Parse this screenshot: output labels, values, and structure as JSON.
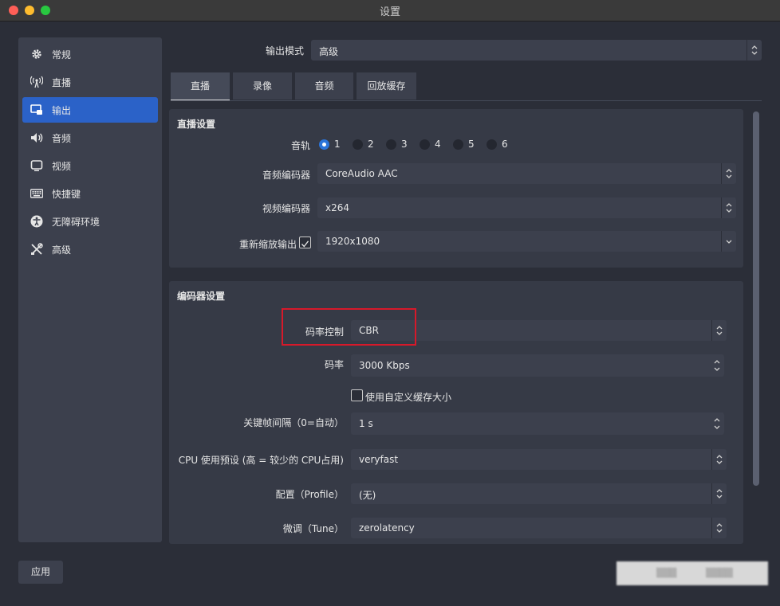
{
  "window": {
    "title": "设置"
  },
  "sidebar": {
    "items": [
      {
        "label": "常规",
        "icon": "gear-icon"
      },
      {
        "label": "直播",
        "icon": "broadcast-icon"
      },
      {
        "label": "输出",
        "icon": "output-icon",
        "active": true
      },
      {
        "label": "音频",
        "icon": "speaker-icon"
      },
      {
        "label": "视频",
        "icon": "monitor-icon"
      },
      {
        "label": "快捷键",
        "icon": "keyboard-icon"
      },
      {
        "label": "无障碍环境",
        "icon": "accessibility-icon"
      },
      {
        "label": "高级",
        "icon": "tools-icon"
      }
    ]
  },
  "output_mode": {
    "label": "输出模式",
    "value": "高级"
  },
  "tabs": [
    {
      "label": "直播",
      "active": true
    },
    {
      "label": "录像"
    },
    {
      "label": "音频"
    },
    {
      "label": "回放缓存"
    }
  ],
  "stream_settings": {
    "title": "直播设置",
    "audio_track_label": "音轨",
    "tracks": [
      "1",
      "2",
      "3",
      "4",
      "5",
      "6"
    ],
    "selected_track": "1",
    "audio_encoder_label": "音频编码器",
    "audio_encoder_value": "CoreAudio AAC",
    "video_encoder_label": "视频编码器",
    "video_encoder_value": "x264",
    "rescale_label": "重新缩放输出",
    "rescale_checked": true,
    "rescale_value": "1920x1080"
  },
  "encoder_settings": {
    "title": "编码器设置",
    "rate_control_label": "码率控制",
    "rate_control_value": "CBR",
    "bitrate_label": "码率",
    "bitrate_value": "3000 Kbps",
    "custom_buffer_label": "使用自定义缓存大小",
    "custom_buffer_checked": false,
    "keyframe_label": "关键帧间隔（0=自动）",
    "keyframe_value": "1 s",
    "cpu_preset_label": "CPU 使用预设 (高 = 较少的 CPU占用)",
    "cpu_preset_value": "veryfast",
    "profile_label": "配置（Profile）",
    "profile_value": "(无)",
    "tune_label": "微调（Tune）",
    "tune_value": "zerolatency"
  },
  "footer": {
    "apply_label": "应用"
  },
  "colors": {
    "accent": "#2b62c8",
    "highlight_box": "#d7192a"
  }
}
